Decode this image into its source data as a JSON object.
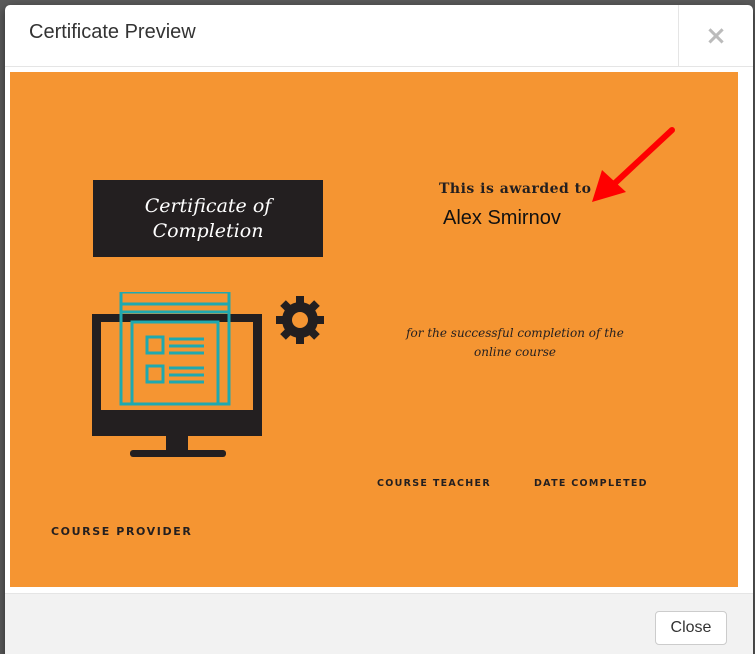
{
  "modal": {
    "title": "Certificate Preview",
    "close_icon": "×",
    "close_button_label": "Close"
  },
  "certificate": {
    "title": "Certificate of Completion",
    "awarded_to_label": "This is awarded to",
    "recipient_name": "Alex Smirnov",
    "completion_text": "for the successful completion of the online course",
    "course_teacher_label": "COURSE TEACHER",
    "date_completed_label": "DATE COMPLETED",
    "course_provider_label": "COURSE PROVIDER"
  },
  "colors": {
    "background": "#f59532",
    "dark": "#231f20",
    "teal": "#1fa9b0",
    "arrow": "#ff0000"
  },
  "icons": [
    "close-icon",
    "computer-illustration",
    "gear-icon",
    "annotation-arrow"
  ]
}
